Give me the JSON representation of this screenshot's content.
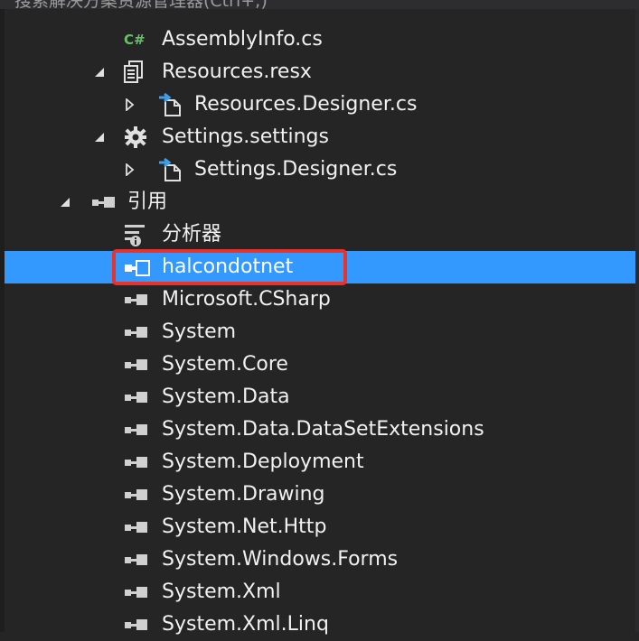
{
  "search": {
    "text": "搜索解决方案资源管理器(Ctrl+;)"
  },
  "tree": [
    {
      "label": "AssemblyInfo.cs",
      "icon": "csharp-file-icon",
      "indent": 2,
      "expander": "none"
    },
    {
      "label": "Resources.resx",
      "icon": "resx-file-icon",
      "indent": 2,
      "expander": "expanded"
    },
    {
      "label": "Resources.Designer.cs",
      "icon": "designer-file-icon",
      "indent": 3,
      "expander": "collapsed"
    },
    {
      "label": "Settings.settings",
      "icon": "settings-gear-icon",
      "indent": 2,
      "expander": "expanded"
    },
    {
      "label": "Settings.Designer.cs",
      "icon": "designer-file-icon",
      "indent": 3,
      "expander": "collapsed"
    },
    {
      "label": "引用",
      "icon": "references-icon",
      "indent": 1,
      "expander": "expanded"
    },
    {
      "label": "分析器",
      "icon": "analyzer-icon",
      "indent": 2,
      "expander": "none"
    },
    {
      "label": "halcondotnet",
      "icon": "reference-icon",
      "indent": 2,
      "expander": "none",
      "selected": true
    },
    {
      "label": "Microsoft.CSharp",
      "icon": "reference-icon",
      "indent": 2,
      "expander": "none"
    },
    {
      "label": "System",
      "icon": "reference-icon",
      "indent": 2,
      "expander": "none"
    },
    {
      "label": "System.Core",
      "icon": "reference-icon",
      "indent": 2,
      "expander": "none"
    },
    {
      "label": "System.Data",
      "icon": "reference-icon",
      "indent": 2,
      "expander": "none"
    },
    {
      "label": "System.Data.DataSetExtensions",
      "icon": "reference-icon",
      "indent": 2,
      "expander": "none"
    },
    {
      "label": "System.Deployment",
      "icon": "reference-icon",
      "indent": 2,
      "expander": "none"
    },
    {
      "label": "System.Drawing",
      "icon": "reference-icon",
      "indent": 2,
      "expander": "none"
    },
    {
      "label": "System.Net.Http",
      "icon": "reference-icon",
      "indent": 2,
      "expander": "none"
    },
    {
      "label": "System.Windows.Forms",
      "icon": "reference-icon",
      "indent": 2,
      "expander": "none"
    },
    {
      "label": "System.Xml",
      "icon": "reference-icon",
      "indent": 2,
      "expander": "none"
    },
    {
      "label": "System.Xml.Linq",
      "icon": "reference-icon",
      "indent": 2,
      "expander": "none"
    }
  ],
  "colors": {
    "background": "#252526",
    "selection": "#3399ff",
    "highlight_border": "#e8332d",
    "csharp_icon": "#68c16a",
    "designer_arrow": "#3f9fe8"
  }
}
